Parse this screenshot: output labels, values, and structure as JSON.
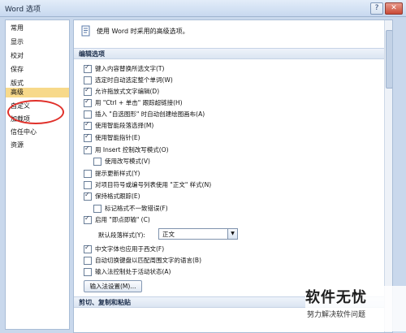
{
  "window": {
    "title": "Word 选项",
    "help": "?",
    "close": "✕"
  },
  "nav": {
    "items": [
      "常用",
      "显示",
      "校对",
      "保存",
      "版式",
      "高级",
      "自定义",
      "加载项",
      "信任中心",
      "资源"
    ],
    "selected_index": 5
  },
  "header": {
    "text": "使用 Word 时采用的高级选项。"
  },
  "sections": {
    "edit": "编辑选项",
    "cut": "剪切、复制和粘贴"
  },
  "options": [
    {
      "label": "键入内容替换所选文字(T)",
      "checked": true,
      "indent": false
    },
    {
      "label": "选定时自动选定整个单词(W)",
      "checked": false,
      "indent": false
    },
    {
      "label": "允许拖放式文字编辑(D)",
      "checked": true,
      "indent": false
    },
    {
      "label": "用 \"Ctrl + 单击\" 跟踪超链接(H)",
      "checked": true,
      "indent": false
    },
    {
      "label": "插入 \"自选图形\" 时自动创建绘图画布(A)",
      "checked": false,
      "indent": false
    },
    {
      "label": "使用智能段落选择(M)",
      "checked": true,
      "indent": false
    },
    {
      "label": "使用智能指针(E)",
      "checked": true,
      "indent": false
    },
    {
      "label": "用 Insert 控制改写模式(O)",
      "checked": true,
      "indent": false
    },
    {
      "label": "使用改写模式(V)",
      "checked": false,
      "indent": true
    },
    {
      "label": "提示更新样式(Y)",
      "checked": false,
      "indent": false
    },
    {
      "label": "对项目符号或编号列表使用 \"正文\" 样式(N)",
      "checked": false,
      "indent": false
    },
    {
      "label": "保持格式跟踪(E)",
      "checked": true,
      "indent": false
    },
    {
      "label": "标记格式不一致错误(F)",
      "checked": false,
      "indent": true
    },
    {
      "label": "启用 \"即点即输\" (C)",
      "checked": true,
      "indent": false
    }
  ],
  "paragraph_style": {
    "label": "默认段落样式(Y):",
    "value": "正文"
  },
  "options2": [
    {
      "label": "中文字体也应用于西文(F)",
      "checked": true
    },
    {
      "label": "自动切换键盘以匹配周围文字的语言(B)",
      "checked": false
    },
    {
      "label": "输入法控制处于活动状态(A)",
      "checked": false
    }
  ],
  "ime_button": "输入法设置(M)...",
  "watermark": {
    "big": "软件无忧",
    "small": "努力解决软件问题"
  }
}
